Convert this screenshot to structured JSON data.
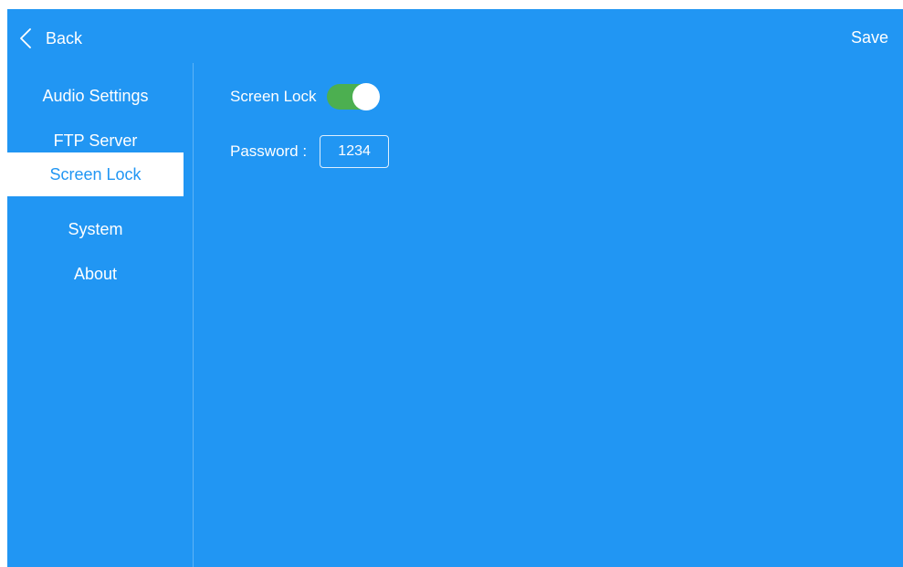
{
  "colors": {
    "background": "#2196f3",
    "toggle_on": "#4caf50",
    "active_item_bg": "#ffffff",
    "active_item_text": "#2196f3"
  },
  "topbar": {
    "back_icon": "chevron-left-icon",
    "back_label": "Back",
    "save_label": "Save"
  },
  "sidebar": {
    "items": [
      {
        "label": "Audio Settings",
        "active": false
      },
      {
        "label": "FTP Server",
        "active": false
      },
      {
        "label": "Screen Lock",
        "active": true
      },
      {
        "label": "System",
        "active": false
      },
      {
        "label": "About",
        "active": false
      }
    ]
  },
  "screen_lock": {
    "label": "Screen Lock",
    "enabled": true,
    "password_label": "Password :",
    "password_value": "1234"
  }
}
